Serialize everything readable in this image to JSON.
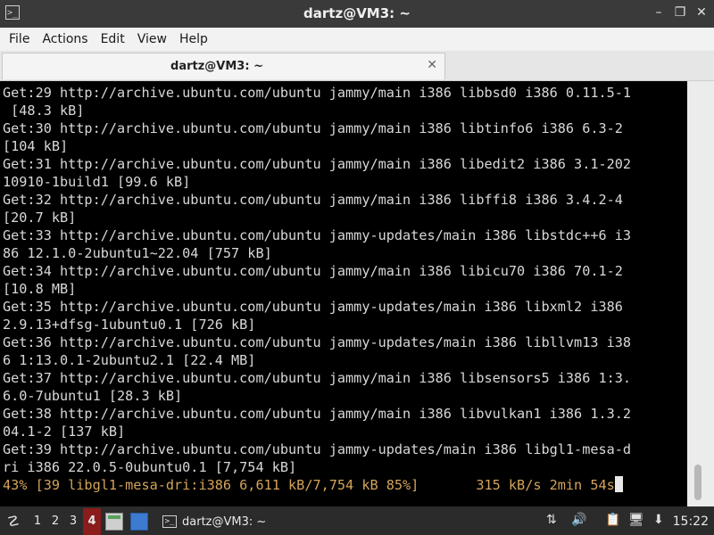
{
  "window": {
    "title": "dartz@VM3: ~",
    "app_icon_glyph": ">_",
    "minimize_glyph": "–",
    "restore_glyph": "❐",
    "close_glyph": "✕"
  },
  "menu": [
    "File",
    "Actions",
    "Edit",
    "View",
    "Help"
  ],
  "tab": {
    "label": "dartz@VM3: ~",
    "close_glyph": "✕"
  },
  "terminal": {
    "lines": [
      "Get:29 http://archive.ubuntu.com/ubuntu jammy/main i386 libbsd0 i386 0.11.5-1",
      " [48.3 kB]",
      "Get:30 http://archive.ubuntu.com/ubuntu jammy/main i386 libtinfo6 i386 6.3-2",
      "[104 kB]",
      "Get:31 http://archive.ubuntu.com/ubuntu jammy/main i386 libedit2 i386 3.1-202",
      "10910-1build1 [99.6 kB]",
      "Get:32 http://archive.ubuntu.com/ubuntu jammy/main i386 libffi8 i386 3.4.2-4",
      "[20.7 kB]",
      "Get:33 http://archive.ubuntu.com/ubuntu jammy-updates/main i386 libstdc++6 i3",
      "86 12.1.0-2ubuntu1~22.04 [757 kB]",
      "Get:34 http://archive.ubuntu.com/ubuntu jammy/main i386 libicu70 i386 70.1-2",
      "[10.8 MB]",
      "Get:35 http://archive.ubuntu.com/ubuntu jammy-updates/main i386 libxml2 i386",
      "2.9.13+dfsg-1ubuntu0.1 [726 kB]",
      "Get:36 http://archive.ubuntu.com/ubuntu jammy-updates/main i386 libllvm13 i38",
      "6 1:13.0.1-2ubuntu2.1 [22.4 MB]",
      "Get:37 http://archive.ubuntu.com/ubuntu jammy/main i386 libsensors5 i386 1:3.",
      "6.0-7ubuntu1 [28.3 kB]",
      "Get:38 http://archive.ubuntu.com/ubuntu jammy/main i386 libvulkan1 i386 1.3.2",
      "04.1-2 [137 kB]",
      "Get:39 http://archive.ubuntu.com/ubuntu jammy-updates/main i386 libgl1-mesa-d",
      "ri i386 22.0.5-0ubuntu0.1 [7,754 kB]"
    ],
    "progress_line": "43% [39 libgl1-mesa-dri:i386 6,611 kB/7,754 kB 85%]       315 kB/s 2min 54s"
  },
  "taskbar": {
    "start_glyph": "☡",
    "workspaces": [
      "1",
      "2",
      "3",
      "4"
    ],
    "active_workspace": "4",
    "task_label": "dartz@VM3: ~",
    "task_icon_glyph": ">_",
    "tray": {
      "network_glyph": "⇅",
      "volume_glyph": "🔊",
      "clipboard_glyph": "📋",
      "display_glyph": "🖥",
      "update_glyph": "⬇"
    },
    "clock": "15:22"
  },
  "colors": {
    "terminal_bg": "#000000",
    "terminal_fg": "#d8d8d8",
    "progress_fg": "#d4a45a",
    "active_workspace": "#8a1c1c"
  }
}
